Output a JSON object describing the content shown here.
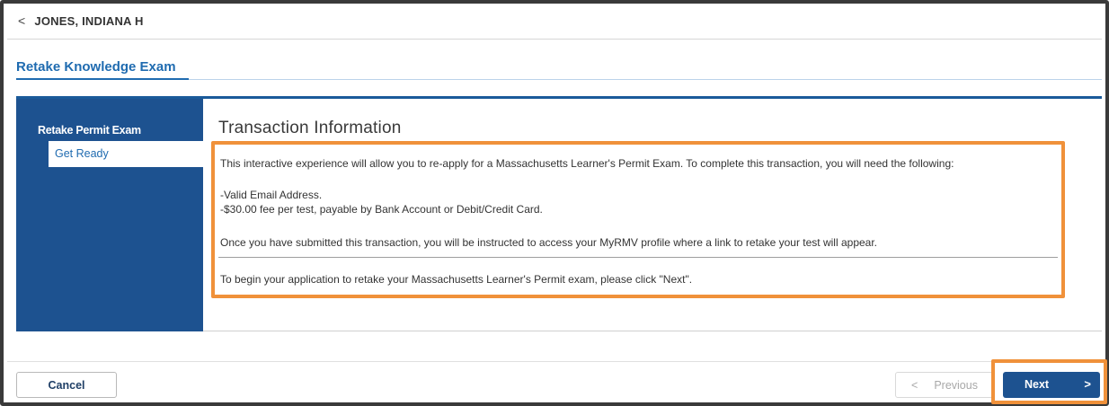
{
  "header": {
    "back_icon": "chevron-left-icon",
    "customer_name": "JONES, INDIANA H"
  },
  "tab": {
    "title": "Retake Knowledge Exam"
  },
  "sidebar": {
    "heading": "Retake Permit Exam",
    "items": [
      {
        "label": "Get Ready",
        "active": true
      }
    ]
  },
  "main": {
    "heading": "Transaction Information",
    "intro": "This interactive experience will allow you to re-apply for a Massachusetts Learner's Permit Exam. To complete this transaction, you will need the following:",
    "requirements": [
      "-Valid Email Address.",
      "-$30.00 fee per test, payable by Bank Account or Debit/Credit Card."
    ],
    "after_submit": "Once you have submitted this transaction, you will be instructed to access your MyRMV profile where a link to retake your test will appear.",
    "instruction": "To begin your application to retake your Massachusetts Learner's Permit exam, please click \"Next\"."
  },
  "footer": {
    "cancel_label": "Cancel",
    "previous_label": "Previous",
    "previous_icon": "chevron-left-icon",
    "next_label": "Next",
    "next_icon": "chevron-right-icon"
  },
  "colors": {
    "brand_blue": "#1d5290",
    "link_blue": "#1f6bb0",
    "highlight_orange": "#f0913a"
  }
}
